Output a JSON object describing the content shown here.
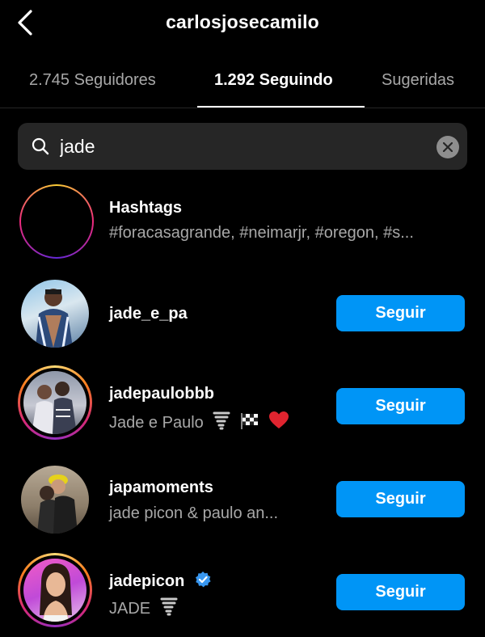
{
  "header": {
    "title": "carlosjosecamilo"
  },
  "tabs": [
    {
      "label": "2.745 Seguidores"
    },
    {
      "label": "1.292 Seguindo"
    },
    {
      "label": "Sugeridas"
    }
  ],
  "search": {
    "value": "jade"
  },
  "results": {
    "hashtags": {
      "title": "Hashtags",
      "tags": "#foracasagrande, #neimarjr, #oregon, #s..."
    },
    "follow_label": "Seguir",
    "users": [
      {
        "username": "jade_e_pa",
        "subtitle": ""
      },
      {
        "username": "jadepaulobbb",
        "subtitle": "Jade e Paulo"
      },
      {
        "username": "japamoments",
        "subtitle": "jade picon & paulo an..."
      },
      {
        "username": "jadepicon",
        "subtitle": "JADE"
      }
    ]
  },
  "colors": {
    "accent": "#0095f6",
    "background": "#000000",
    "secondary_text": "#a8a8a8",
    "verified": "#3897f0"
  },
  "icons": [
    "back-chevron-icon",
    "search-icon",
    "clear-icon",
    "hashtag-icon",
    "verified-badge-icon",
    "tornado-emoji-icon",
    "checkered-flag-emoji-icon",
    "red-heart-emoji-icon"
  ]
}
